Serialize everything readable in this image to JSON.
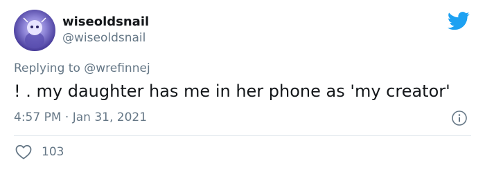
{
  "author": {
    "display_name": "wiseoldsnail",
    "handle": "@wiseoldsnail"
  },
  "reply": {
    "prefix": "Replying to ",
    "mention": "@wrefinnej"
  },
  "tweet": {
    "text": "! . my daughter has me in her phone as 'my creator'"
  },
  "meta": {
    "time": "4:57 PM",
    "separator": " · ",
    "date": "Jan 31, 2021"
  },
  "engagement": {
    "likes": "103"
  },
  "icons": {
    "brand": "twitter-bird-icon",
    "info": "info-icon",
    "like": "heart-icon"
  },
  "colors": {
    "brand_blue": "#1da1f2",
    "secondary_text": "#657786",
    "primary_text": "#14171a"
  }
}
